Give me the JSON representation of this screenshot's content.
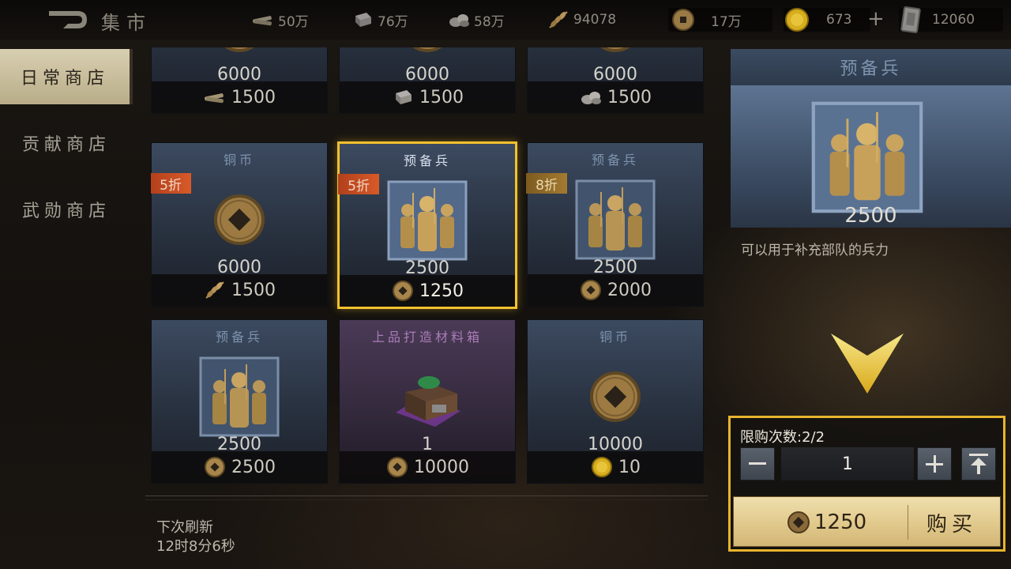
{
  "header": {
    "title": "集市",
    "resources": [
      {
        "icon": "wood-icon",
        "value": "50万"
      },
      {
        "icon": "iron-icon",
        "value": "76万"
      },
      {
        "icon": "stone-icon",
        "value": "58万"
      },
      {
        "icon": "grain-icon",
        "value": "94078"
      },
      {
        "icon": "copper-coin-icon",
        "value": "17万"
      },
      {
        "icon": "gold-coin-icon",
        "value": "673"
      },
      {
        "icon": "jade-token-icon",
        "value": "12060"
      }
    ],
    "plus_label": "+"
  },
  "sidebar": {
    "items": [
      {
        "label": "日常商店",
        "active": true
      },
      {
        "label": "贡献商店",
        "active": false
      },
      {
        "label": "武勋商店",
        "active": false
      }
    ]
  },
  "shop": {
    "items": [
      {
        "name": "",
        "icon": "copper-coin-icon",
        "qty": "6000",
        "price": "1500",
        "price_icon": "wood-icon",
        "discount": ""
      },
      {
        "name": "",
        "icon": "copper-coin-icon",
        "qty": "6000",
        "price": "1500",
        "price_icon": "iron-icon",
        "discount": ""
      },
      {
        "name": "",
        "icon": "copper-coin-icon",
        "qty": "6000",
        "price": "1500",
        "price_icon": "stone-icon",
        "discount": ""
      },
      {
        "name": "铜币",
        "icon": "copper-coin-icon",
        "qty": "6000",
        "price": "1500",
        "price_icon": "grain-icon",
        "discount": "5折"
      },
      {
        "name": "预备兵",
        "icon": "reserve-soldiers-icon",
        "qty": "2500",
        "price": "1250",
        "price_icon": "copper-coin-icon",
        "discount": "5折",
        "selected": true
      },
      {
        "name": "预备兵",
        "icon": "reserve-soldiers-icon",
        "qty": "2500",
        "price": "2000",
        "price_icon": "copper-coin-icon",
        "discount": "8折"
      },
      {
        "name": "预备兵",
        "icon": "reserve-soldiers-icon",
        "qty": "2500",
        "price": "2500",
        "price_icon": "copper-coin-icon",
        "discount": ""
      },
      {
        "name": "上品打造材料箱",
        "icon": "material-chest-icon",
        "qty": "1",
        "price": "10000",
        "price_icon": "copper-coin-icon",
        "discount": ""
      },
      {
        "name": "铜币",
        "icon": "copper-coin-icon",
        "qty": "10000",
        "price": "10",
        "price_icon": "gold-coin-icon",
        "discount": ""
      }
    ],
    "refresh_label": "下次刷新",
    "refresh_time": "12时8分6秒"
  },
  "detail": {
    "name": "预备兵",
    "qty": "2500",
    "description": "可以用于补充部队的兵力"
  },
  "purchase": {
    "limit_text": "限购次数:2/2",
    "quantity": "1",
    "price": "1250",
    "buy_label": "购买"
  },
  "colors": {
    "highlight": "#f2c12e",
    "discount_red": "#d85a28",
    "discount_gold": "#a37a30"
  }
}
